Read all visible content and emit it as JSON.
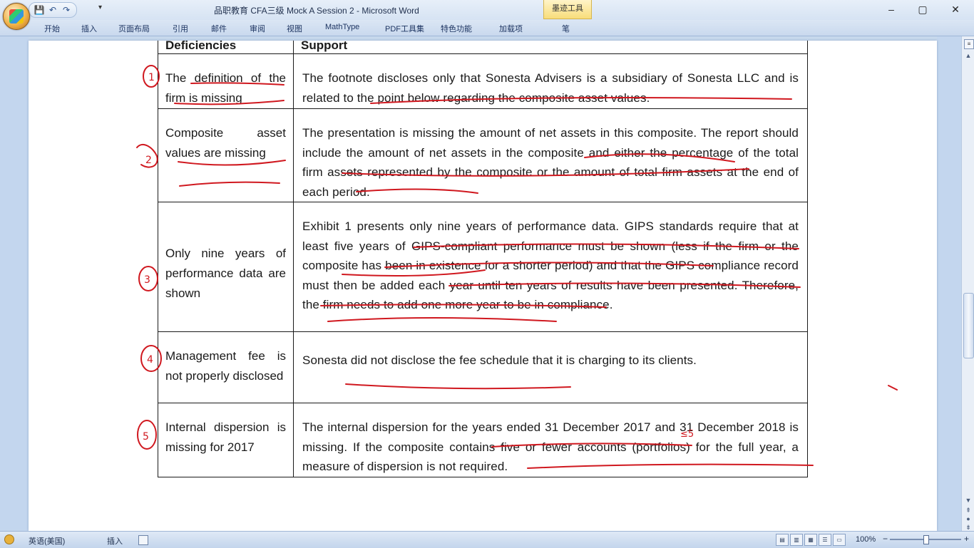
{
  "window": {
    "title": "品职教育 CFA三级 Mock A Session 2 - Microsoft Word",
    "context_tab": "墨迹工具",
    "minimize": "–",
    "maximize": "▢",
    "close": "✕"
  },
  "ribbon_tabs": [
    "开始",
    "插入",
    "页面布局",
    "引用",
    "邮件",
    "审阅",
    "视图",
    "MathType",
    "PDF工具集",
    "特色功能",
    "加载项",
    "笔"
  ],
  "qat": {
    "save": "💾",
    "undo": "↶",
    "redo": "↷",
    "more": "▾"
  },
  "table": {
    "headers": [
      "Deficiencies",
      "Support"
    ],
    "rows": [
      {
        "deficiency": "The definition of the firm is missing",
        "support": "The footnote discloses only that Sonesta Advisers is a subsidiary of Sonesta LLC and is related to the point below regarding the composite asset values."
      },
      {
        "deficiency": "Composite asset values are missing",
        "support": "The presentation is missing the amount of net assets in this composite. The report should include the amount of net assets in the composite and either the percentage of the total firm assets represented by the composite or the amount of total firm assets at the end of each period."
      },
      {
        "deficiency": "Only nine years of performance data are shown",
        "support": "Exhibit 1 presents only nine years of performance data. GIPS standards require that at least five years of GIPS-compliant performance must be shown (less if the firm or the composite has been in existence for a shorter period) and that the GIPS compliance record must then be added each year until ten years of results have been presented. Therefore, the firm needs to add one more year to be in compliance."
      },
      {
        "deficiency": "Management fee is not properly disclosed",
        "support": "Sonesta did not disclose the fee schedule that it is charging to its clients."
      },
      {
        "deficiency": "Internal dispersion is missing for 2017",
        "support": "The internal dispersion for the years ended 31 December 2017 and 31 December 2018 is missing. If the composite contains five or fewer accounts (portfolios) for the full year, a measure of dispersion is not required."
      }
    ]
  },
  "annotations": {
    "numbers": [
      "1",
      "2",
      "3",
      "4",
      "5"
    ],
    "note": "≤5",
    "ink_color": "#d0181f"
  },
  "status_bar": {
    "language": "英语(美国)",
    "insert_mode": "插入",
    "zoom": "100%",
    "zoom_minus": "−",
    "zoom_plus": "+"
  }
}
